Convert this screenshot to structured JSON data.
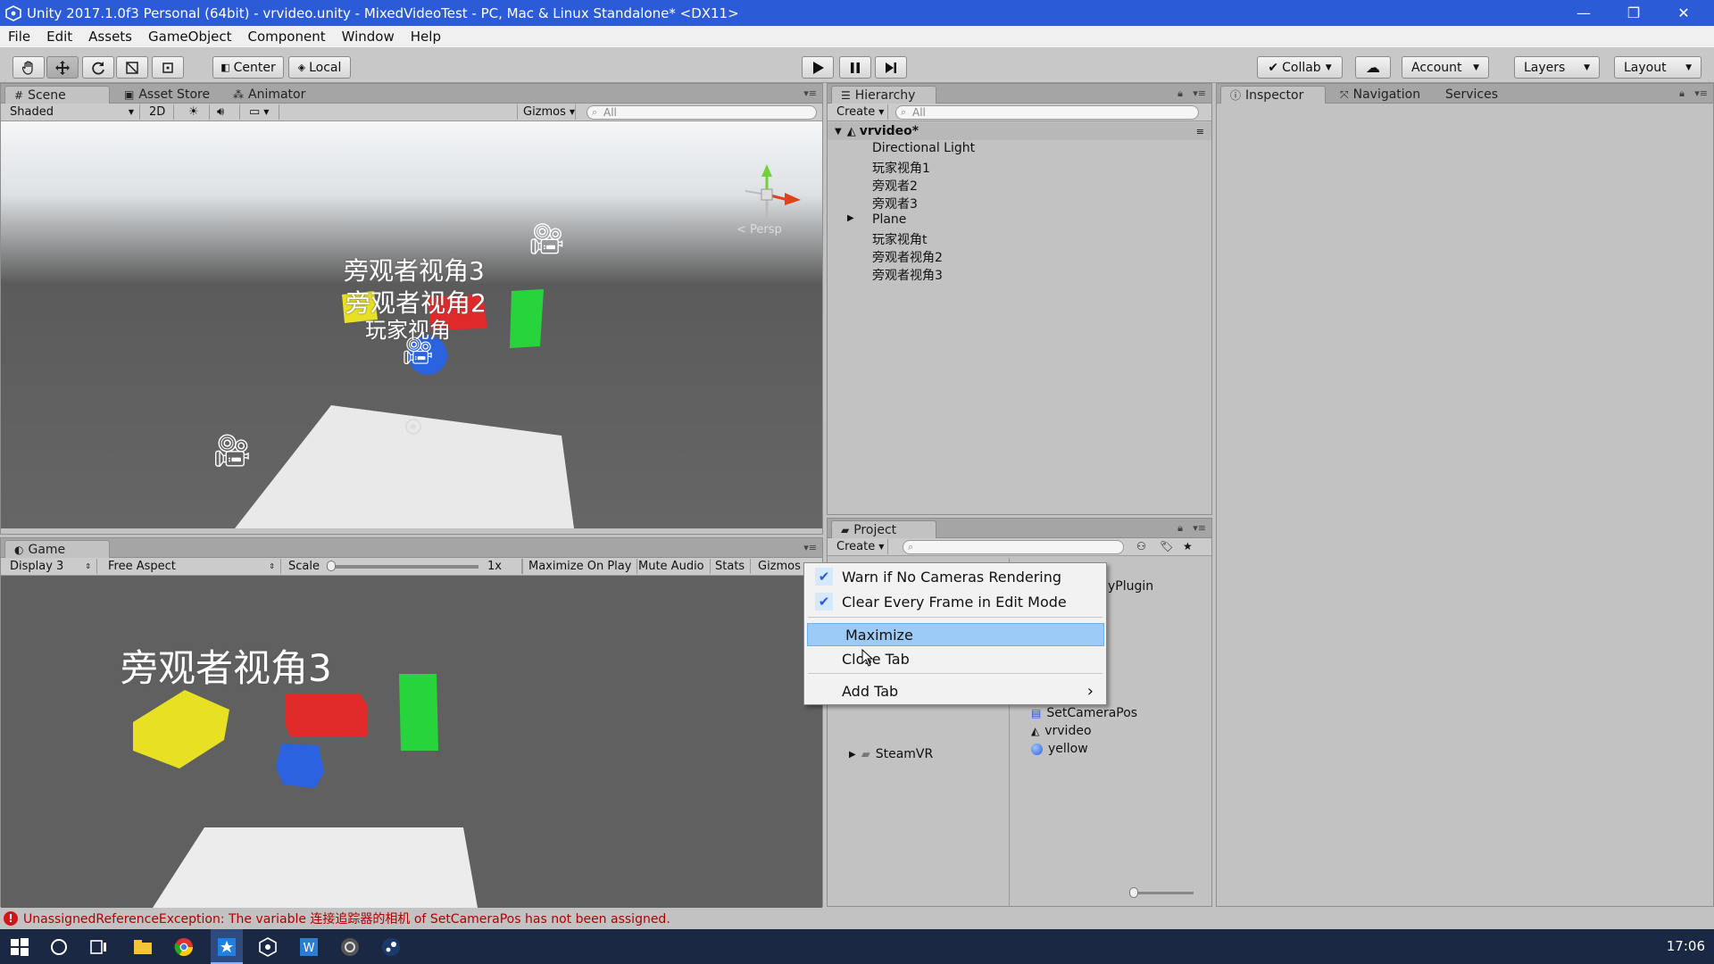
{
  "window": {
    "title": "Unity 2017.1.0f3 Personal (64bit) - vrvideo.unity - MixedVideoTest - PC, Mac & Linux Standalone* <DX11>",
    "minimize": "—",
    "restore": "❐",
    "close": "✕"
  },
  "menu": [
    "File",
    "Edit",
    "Assets",
    "GameObject",
    "Component",
    "Window",
    "Help"
  ],
  "toolbar": {
    "center": "Center",
    "local": "Local",
    "collab": "Collab",
    "account": "Account",
    "layers": "Layers",
    "layout": "Layout"
  },
  "scene_panel": {
    "tabs": [
      "Scene",
      "Asset Store",
      "Animator"
    ],
    "shading": "Shaded",
    "mode_2d": "2D",
    "gizmos": "Gizmos",
    "search_placeholder": "All",
    "persp": "Persp",
    "labels": [
      "旁观者视角3",
      "旁观者视角2",
      "玩家视角"
    ]
  },
  "game_panel": {
    "tab": "Game",
    "display": "Display 3",
    "aspect": "Free Aspect",
    "scale_label": "Scale",
    "scale_value": "1x",
    "scale_level": 0.0,
    "maximize_on_play": "Maximize On Play",
    "mute_audio": "Mute Audio",
    "stats": "Stats",
    "gizmos": "Gizmos",
    "overlay_label": "旁观者视角3"
  },
  "hierarchy": {
    "tab": "Hierarchy",
    "create": "Create",
    "search_placeholder": "All",
    "scene_name": "vrvideo*",
    "items": [
      "Directional Light",
      "玩家视角1",
      "旁观者2",
      "旁观者3",
      "Plane",
      "玩家视角t",
      "旁观者视角2",
      "旁观者视角3"
    ]
  },
  "inspector": {
    "tabs": [
      "Inspector",
      "Navigation",
      "Services"
    ]
  },
  "project": {
    "tab": "Project",
    "create": "Create",
    "folder_partial": "yPlugin",
    "steamvr": "SteamVR",
    "assets": [
      "SetCameraPos",
      "vrvideo",
      "yellow"
    ]
  },
  "context_menu": {
    "items": [
      {
        "label": "Warn if No Cameras Rendering",
        "checked": true
      },
      {
        "label": "Clear Every Frame in Edit Mode",
        "checked": true
      },
      {
        "label": "Maximize",
        "checked": false
      },
      {
        "label": "Close Tab",
        "checked": false
      },
      {
        "label": "Add Tab",
        "checked": false
      }
    ],
    "submenu_arrow": "›"
  },
  "status": {
    "message": "UnassignedReferenceException: The variable 连接追踪器的相机 of SetCameraPos has not been assigned."
  },
  "taskbar": {
    "time": "17:06"
  },
  "colors": {
    "titlebar": "#2b5bd7",
    "highlight": "#9ccbf7",
    "cube_yellow": "#e8e023",
    "cube_red": "#e02a2a",
    "cube_green": "#27d43c",
    "cube_blue": "#2a62e0"
  }
}
